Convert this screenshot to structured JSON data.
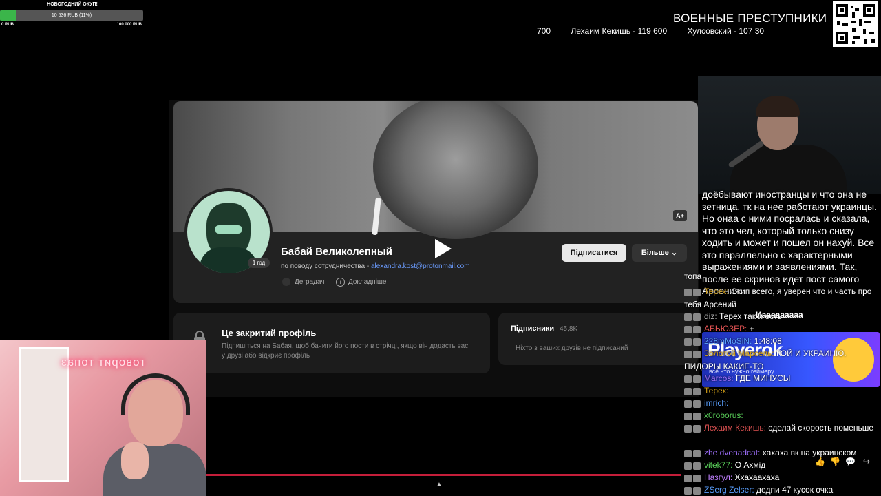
{
  "goal": {
    "title": "НОВОГОДНИЙ ОКУП!",
    "amount": "10 536 RUB (11%)",
    "progress": 0.11,
    "min_label": "0 RUB",
    "max_label": "100 000 RUB",
    "fill_color": "#3bb54a"
  },
  "war_board": {
    "title": "ВОЕННЫЕ ПРЕСТУПНИКИ",
    "entries": [
      "700",
      "Лехаим Кекишь - 119 600",
      "Хулсовский - 107 30"
    ]
  },
  "profile": {
    "name": "Бабай Великолепный",
    "sub_prefix": "по поводу сотрудничества - ",
    "email": "alexandra.kost@protonmail.com",
    "age_badge": "1 год",
    "degrad_label": "Деградач",
    "details_label": "Докладніше",
    "subscribe_label": "Підписатися",
    "more_label": "Більше",
    "aplus_label": "A+",
    "closed_title": "Це закритий профіль",
    "closed_desc": "Підпишіться на Бабая, щоб бачити його пости в стрічці, якщо він додасть вас у друзі або відкриє профіль",
    "subs_title": "Підписники",
    "subs_count": "45,8K",
    "subs_empty": "Ніхто з ваших друзів не підписаний"
  },
  "cam_left": {
    "neon": "говорит топаз"
  },
  "transcript": "доёбывают иностранцы и что она не зетница, тк на нее работают украинцы. Но онаа с ними посралась и сказала, что это чел, который только снизу ходить и может и пошел он нахуй. Все это параллельно с характерными выражениями и заявлениями. Так, после ее скринов идет пост самого Арсения.",
  "ad": {
    "logo": "Playerok",
    "tagline": "всё что нужно геймеру"
  },
  "chat": [
    {
      "name": "",
      "color": "#ffffff",
      "text": "топа"
    },
    {
      "name": "Терех",
      "color": "#d4a017",
      "text": "Скип всего, я уверен что и часть про тебя Арсений"
    },
    {
      "name": "diz",
      "color": "#aaaaaa",
      "text": "Терех так и есть"
    },
    {
      "name": "АБЬЮЗЕР",
      "color": "#e05252",
      "text": "+"
    },
    {
      "name": "228mMoSiN",
      "color": "#5aa0ff",
      "text": "1:48:08"
    },
    {
      "name": "Золотой Марсель",
      "color": "#d4a017",
      "text": "ГОЙ И УКРАИНЮ. ПИДОРЫ КАКИЕ-ТО"
    },
    {
      "name": "Marcos",
      "color": "#a070ff",
      "text": "ГДЕ МИНУСЫ"
    },
    {
      "name": "Терех",
      "color": "#d4a017",
      "text": ""
    },
    {
      "name": "imrich",
      "color": "#5aa0ff",
      "text": ""
    },
    {
      "name": "x0roborus",
      "color": "#5ad05a",
      "text": ""
    },
    {
      "name": "Лехаим Кекишь",
      "color": "#e05252",
      "text": "сделай скорость поменьше"
    },
    {
      "name": "zhe dvenadcat",
      "color": "#a070ff",
      "text": "хахаха вк на украинском"
    },
    {
      "name": "vitek77",
      "color": "#5ad05a",
      "text": "О Ахмід"
    },
    {
      "name": "Назгул",
      "color": "#c080ff",
      "text": "Ххахаахаха"
    },
    {
      "name": "ZSerg Zelser",
      "color": "#5aa0ff",
      "text": "дедпи 47 кусок очка"
    }
  ],
  "chat_extra": {
    "spam": "Иааааааааа"
  }
}
